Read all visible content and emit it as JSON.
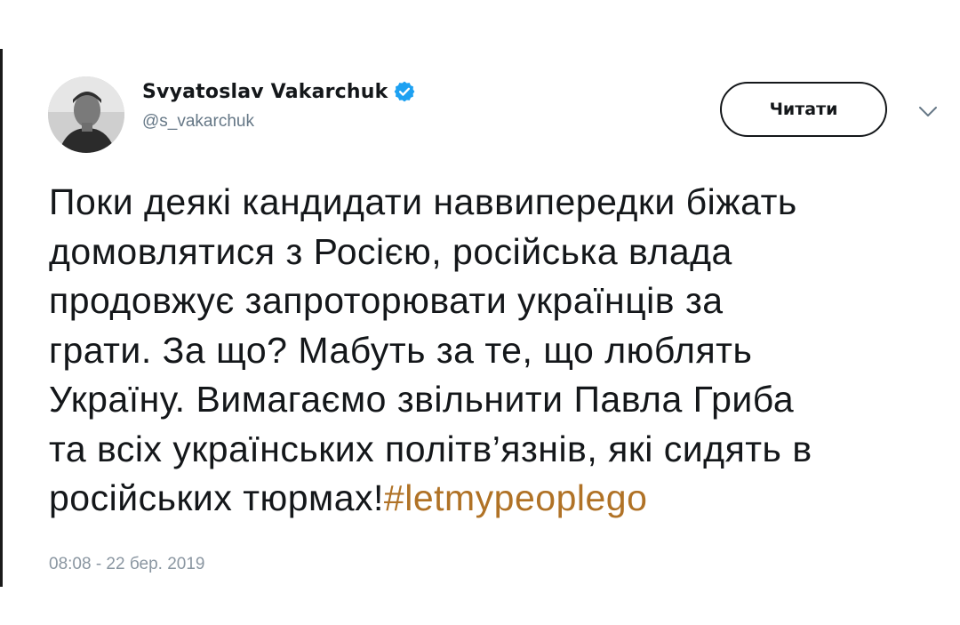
{
  "tweet": {
    "author": {
      "display_name": "Svyatoslav Vakarchuk",
      "handle": "@s_vakarchuk",
      "verified": true
    },
    "follow_button_label": "Читати",
    "text_lines": [
      "Поки деякі кандидати наввипередки біжать",
      "домовлятися з Росією, російська влада",
      "продовжує запроторювати українців за",
      "грати. За що? Мабуть за те, що люблять",
      "Україну. Вимагаємо звільнити Павла Гриба",
      "та всіх українських політв’язнів, які сидять в",
      "російських тюрмах!"
    ],
    "hashtag": "#letmypeoplego",
    "timestamp": "08:08 - 22 бер. 2019"
  },
  "colors": {
    "text": "#14171a",
    "secondary": "#657786",
    "verified_badge": "#1da1f2",
    "hashtag": "#b07226"
  },
  "icons": {
    "verified": "verified-badge-icon",
    "more": "chevron-down-icon"
  }
}
